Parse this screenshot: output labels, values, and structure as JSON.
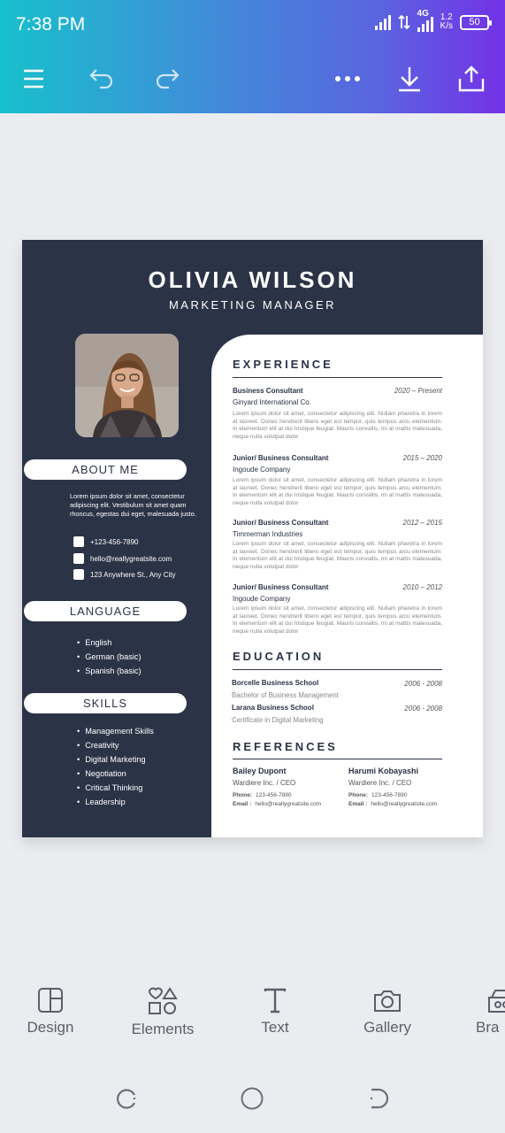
{
  "status_bar": {
    "time": "7:38 PM",
    "network": "4G",
    "speed_value": "1.2",
    "speed_unit": "K/s",
    "battery": "50"
  },
  "toolbar": {
    "icons": [
      "menu-icon",
      "undo-icon",
      "redo-icon",
      "more-icon",
      "download-icon",
      "share-icon"
    ]
  },
  "resume": {
    "name": "OLIVIA WILSON",
    "role": "MARKETING MANAGER",
    "about_title": "ABOUT ME",
    "about_text": "Lorem ipsum dolor sit amet, consectetur adipiscing elit. Vestibulum sit amet quam rhoncus, egestas dui eget, malesuada justo.",
    "contact": {
      "phone": "+123-456-7890",
      "email": "hello@reallygreatsite.com",
      "address": "123 Anywhere St., Any City"
    },
    "language_title": "LANGUAGE",
    "languages": [
      "English",
      "German (basic)",
      "Spanish (basic)"
    ],
    "skills_title": "SKILLS",
    "skills": [
      "Management Skills",
      "Creativity",
      "Digital Marketing",
      "Negotiation",
      "Critical Thinking",
      "Leadership"
    ],
    "experience_title": "EXPERIENCE",
    "experience": [
      {
        "title": "Business Consultant",
        "date": "2020 – Present",
        "company": "Ginyard International Co.",
        "text": "Lorem ipsum dolor sit amet, consectetur adipiscing elit. Nullam pharetra in lorem at laoreet. Donec hendrerit libero eget est tempor, quis tempus arcu elementum. In elementum elit at dui tristique feugiat. Mauris convallis, mi at mattis malesuada, neque nulla volutpat dolor"
      },
      {
        "title": "Junior/ Business Consultant",
        "date": "2015 – 2020",
        "company": "Ingoude Company",
        "text": "Lorem ipsum dolor sit amet, consectetur adipiscing elit. Nullam pharetra in lorem at laoreet. Donec hendrerit libero eget est tempor, quis tempus arcu elementum. In elementum elit at dui tristique feugiat. Mauris convallis, mi at mattis malesuada, neque nulla volutpat dolor"
      },
      {
        "title": "Junior/ Business Consultant",
        "date": "2012 – 2015",
        "company": "Timmerman Industries",
        "text": "Lorem ipsum dolor sit amet, consectetur adipiscing elit. Nullam pharetra in lorem at laoreet. Donec hendrerit libero eget est tempor, quis tempus arcu elementum. In elementum elit at dui tristique feugiat. Mauris convallis, mi at mattis malesuada, neque nulla volutpat dolor"
      },
      {
        "title": "Junior/ Business Consultant",
        "date": "2010 – 2012",
        "company": "Ingoude Company",
        "text": "Lorem ipsum dolor sit amet, consectetur adipiscing elit. Nullam pharetra in lorem at laoreet. Donec hendrerit libero eget est tempor, quis tempus arcu elementum. In elementum elit at dui tristique feugiat. Mauris convallis, mi at mattis malesuada, neque nulla volutpat dolor"
      }
    ],
    "education_title": "EDUCATION",
    "education": [
      {
        "school": "Borcelle Business School",
        "date": "2006 - 2008",
        "degree": "Bachelor of Business Management"
      },
      {
        "school": "Larana Business School",
        "date": "2006 - 2008",
        "degree": "Certificate in Digital Marketing"
      }
    ],
    "references_title": "REFERENCES",
    "references": [
      {
        "name": "Bailey Dupont",
        "company": "Wardiere Inc. / CEO",
        "phone_label": "Phone:",
        "phone": "123-456-7890",
        "email_label": "Email :",
        "email": "hello@reallygreatsite.com"
      },
      {
        "name": "Harumi Kobayashi",
        "company": "Wardiere Inc. / CEO",
        "phone_label": "Phone:",
        "phone": "123-456-7890",
        "email_label": "Email :",
        "email": "hello@reallygreatsite.com"
      }
    ]
  },
  "bottom_tools": [
    {
      "label": "Design",
      "icon": "layout-icon"
    },
    {
      "label": "Elements",
      "icon": "shapes-icon"
    },
    {
      "label": "Text",
      "icon": "text-icon"
    },
    {
      "label": "Gallery",
      "icon": "camera-icon"
    },
    {
      "label": "Bra",
      "icon": "brand-icon"
    }
  ],
  "colors": {
    "navy": "#2b3347",
    "gradient_start": "#17c0cc",
    "gradient_end": "#7431e6"
  }
}
